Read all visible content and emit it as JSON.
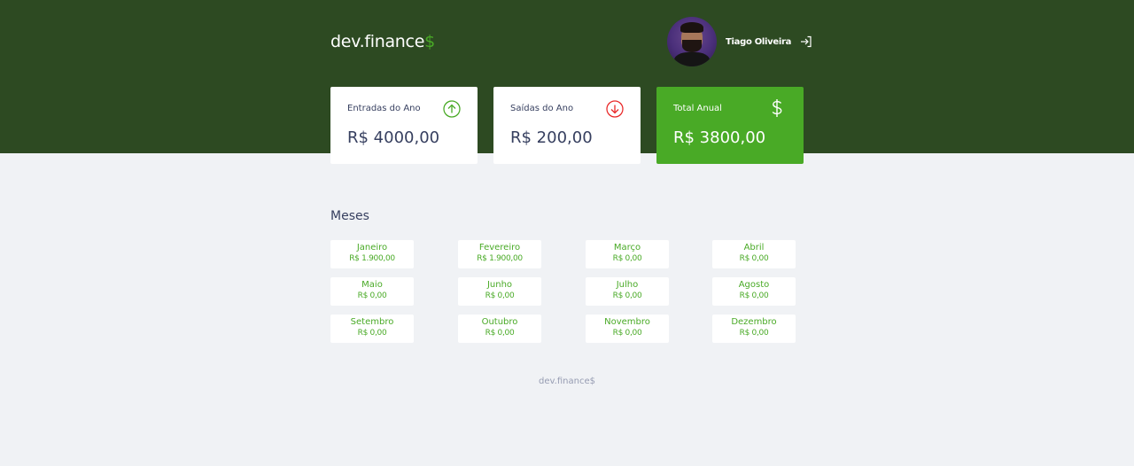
{
  "header": {
    "logo_text": "dev.finance",
    "logo_dollar": "$",
    "user_name": "Tiago Oliveira",
    "logout_icon": "logout-icon",
    "background_color": "#2d4a22"
  },
  "cards": [
    {
      "label": "Entradas do Ano",
      "value": "R$ 4000,00",
      "icon": "arrow-up-circle-icon"
    },
    {
      "label": "Saídas do Ano",
      "value": "R$ 200,00",
      "icon": "arrow-down-circle-icon"
    },
    {
      "label": "Total Anual",
      "value": "R$ 3800,00",
      "icon": "dollar-sign-icon"
    }
  ],
  "months_section": {
    "title": "Meses",
    "months": [
      {
        "name": "Janeiro",
        "value": "R$ 1.900,00"
      },
      {
        "name": "Fevereiro",
        "value": "R$ 1.900,00"
      },
      {
        "name": "Março",
        "value": "R$ 0,00"
      },
      {
        "name": "Abril",
        "value": "R$ 0,00"
      },
      {
        "name": "Maio",
        "value": "R$ 0,00"
      },
      {
        "name": "Junho",
        "value": "R$ 0,00"
      },
      {
        "name": "Julho",
        "value": "R$ 0,00"
      },
      {
        "name": "Agosto",
        "value": "R$ 0,00"
      },
      {
        "name": "Setembro",
        "value": "R$ 0,00"
      },
      {
        "name": "Outubro",
        "value": "R$ 0,00"
      },
      {
        "name": "Novembro",
        "value": "R$ 0,00"
      },
      {
        "name": "Dezembro",
        "value": "R$ 0,00"
      }
    ]
  },
  "footer": {
    "text": "dev.finance$"
  },
  "colors": {
    "accent_green": "#49aa26",
    "expense_red": "#e92929",
    "text_dark": "#363f5f",
    "page_bg": "#f0f2f5"
  }
}
